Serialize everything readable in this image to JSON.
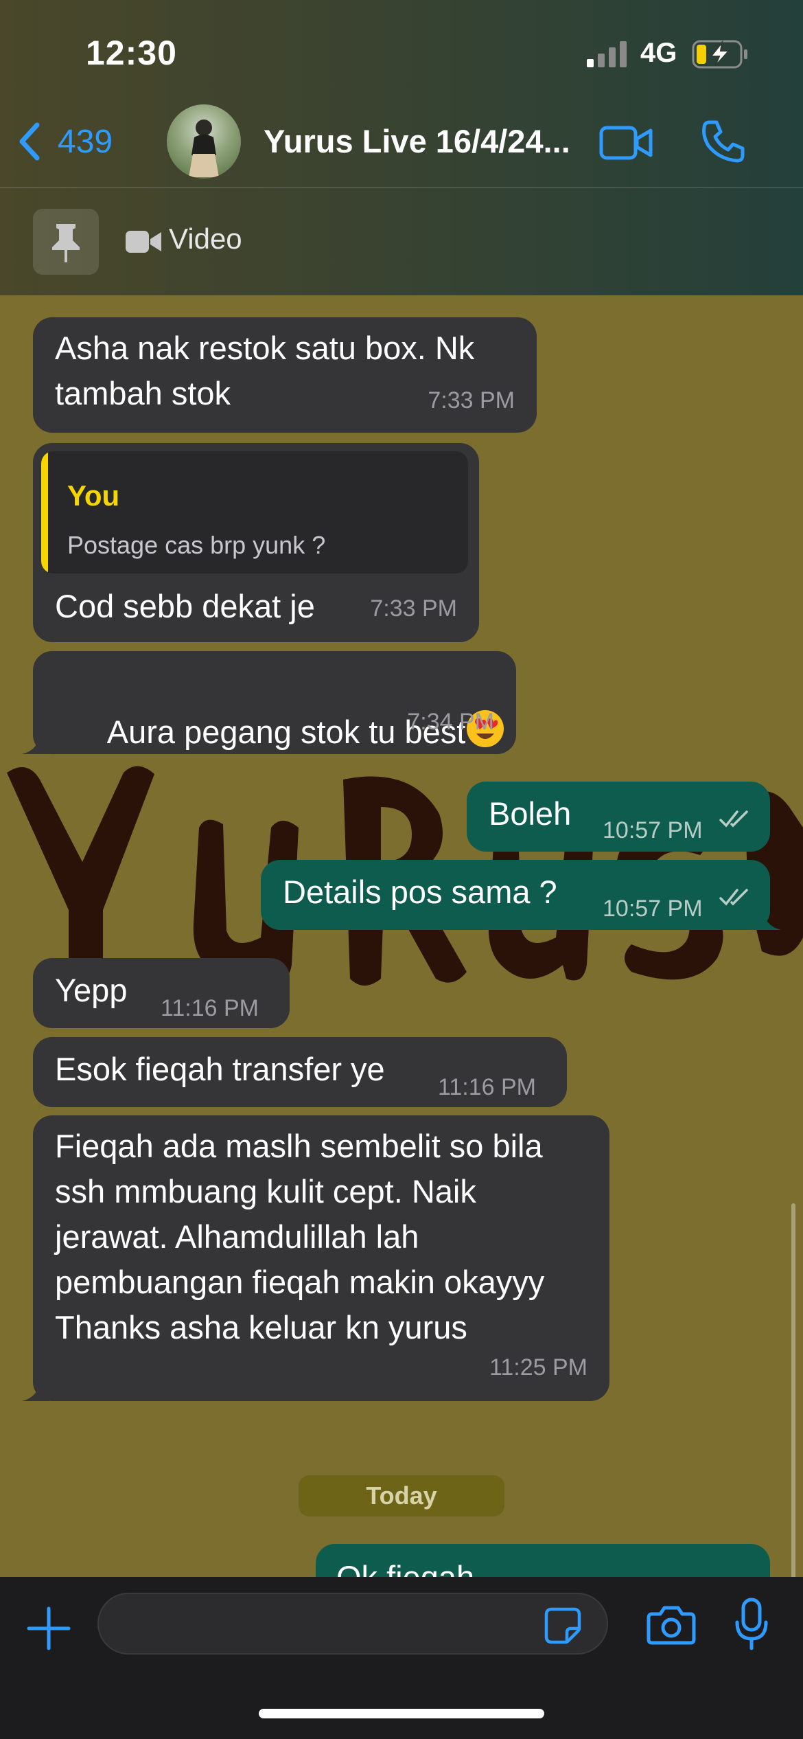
{
  "status_bar": {
    "time": "12:30",
    "network": "4G"
  },
  "header": {
    "back_count": "439",
    "chat_title": "Yurus Live 16/4/24...",
    "icons": [
      "chevron-left-icon",
      "avatar",
      "video-call-icon",
      "phone-icon"
    ]
  },
  "pinned": {
    "label": "Video"
  },
  "messages": [
    {
      "direction": "in",
      "text": "Asha nak restok satu box. Nk\ntambah stok",
      "time": "7:33 PM"
    },
    {
      "direction": "in",
      "reply_to": {
        "name": "You",
        "text": "Postage cas brp yunk ?"
      },
      "text": "Cod sebb dekat je",
      "time": "7:33 PM"
    },
    {
      "direction": "in",
      "text": "Aura pegang stok tu best",
      "emoji": "heart-eyes-emoji",
      "time": "7:34 PM"
    },
    {
      "direction": "out",
      "text": "Boleh",
      "time": "10:57 PM",
      "status": "read"
    },
    {
      "direction": "out",
      "text": "Details pos sama ?",
      "time": "10:57 PM",
      "status": "read"
    },
    {
      "direction": "in",
      "text": "Yepp",
      "time": "11:16 PM"
    },
    {
      "direction": "in",
      "text": "Esok fieqah transfer ye",
      "time": "11:16 PM"
    },
    {
      "direction": "in",
      "text": "Fieqah ada maslh sembelit so bila\nssh mmbuang kulit cept. Naik\njerawat. Alhamdulillah lah\npembuangan fieqah makin okayyy\nThanks asha keluar kn yurus",
      "time": "11:25 PM"
    },
    {
      "direction": "out",
      "text": "Ok fieqah",
      "time": ""
    }
  ],
  "date_separator": "Today",
  "colors": {
    "wallpaper": "#7b6e2e",
    "incoming_bubble": "#353537",
    "outgoing_bubble": "#0d5c4e",
    "accent_blue": "#2f9bff",
    "reply_yellow": "#f5d600"
  }
}
